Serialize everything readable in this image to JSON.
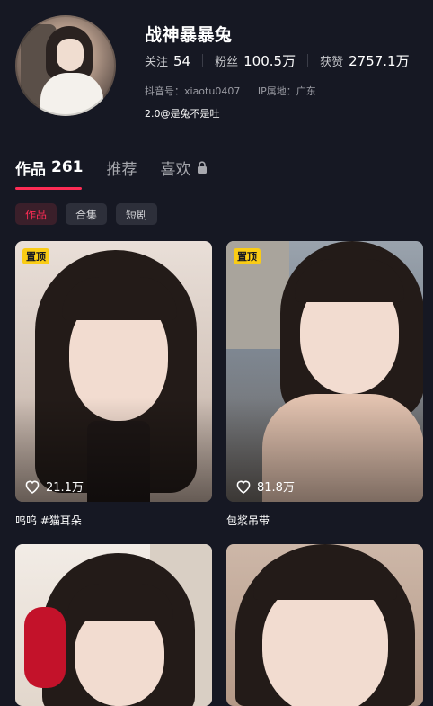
{
  "profile": {
    "name": "战神暴暴兔",
    "stats": [
      {
        "label": "关注",
        "value": "54"
      },
      {
        "label": "粉丝",
        "value": "100.5万"
      },
      {
        "label": "获赞",
        "value": "2757.1万"
      }
    ],
    "douyin_id": "抖音号：xiaotu0407",
    "ip_location": "IP属地：广东",
    "bio": "2.0@是兔不是吐"
  },
  "tabs": [
    {
      "label": "作品",
      "count": "261"
    },
    {
      "label": "推荐"
    },
    {
      "label": "喜欢",
      "icon": "lock-icon"
    }
  ],
  "chips": [
    "作品",
    "合集",
    "短剧"
  ],
  "videos": [
    {
      "pinned": true,
      "pin_label": "置顶",
      "likes": "21.1万",
      "caption": "呜呜 #猫耳朵"
    },
    {
      "pinned": true,
      "pin_label": "置顶",
      "likes": "81.8万",
      "caption": "包浆吊带"
    },
    {
      "pinned": false
    },
    {
      "pinned": false
    }
  ],
  "colors": {
    "accent": "#fe2c55",
    "pin": "#facc15",
    "background": "#161823"
  }
}
